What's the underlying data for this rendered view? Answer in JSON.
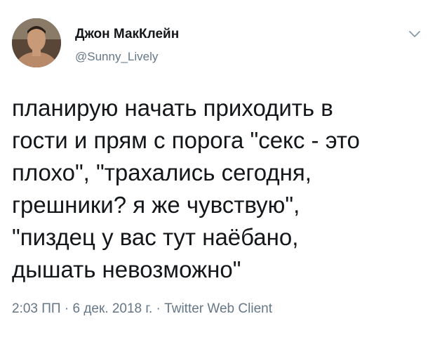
{
  "author": {
    "display_name": "Джон МакКлейн",
    "handle": "@Sunny_Lively",
    "avatar_icon": "user-avatar-photo"
  },
  "menu_icon": "chevron-down-icon",
  "tweet": {
    "text": "планирую начать приходить в\nгости и прям с порога \"секс - это\nплохо\", \"трахались сегодня,\nгрешники? я же чувствую\",\n\"пиздец у вас тут наёбано,\nдышать невозможно\""
  },
  "meta": {
    "time": "2:03 ПП",
    "separator": " · ",
    "date": "6 дек. 2018 г.",
    "client": "Twitter Web Client"
  },
  "colors": {
    "text": "#14171a",
    "secondary": "#657786",
    "background": "#ffffff"
  }
}
